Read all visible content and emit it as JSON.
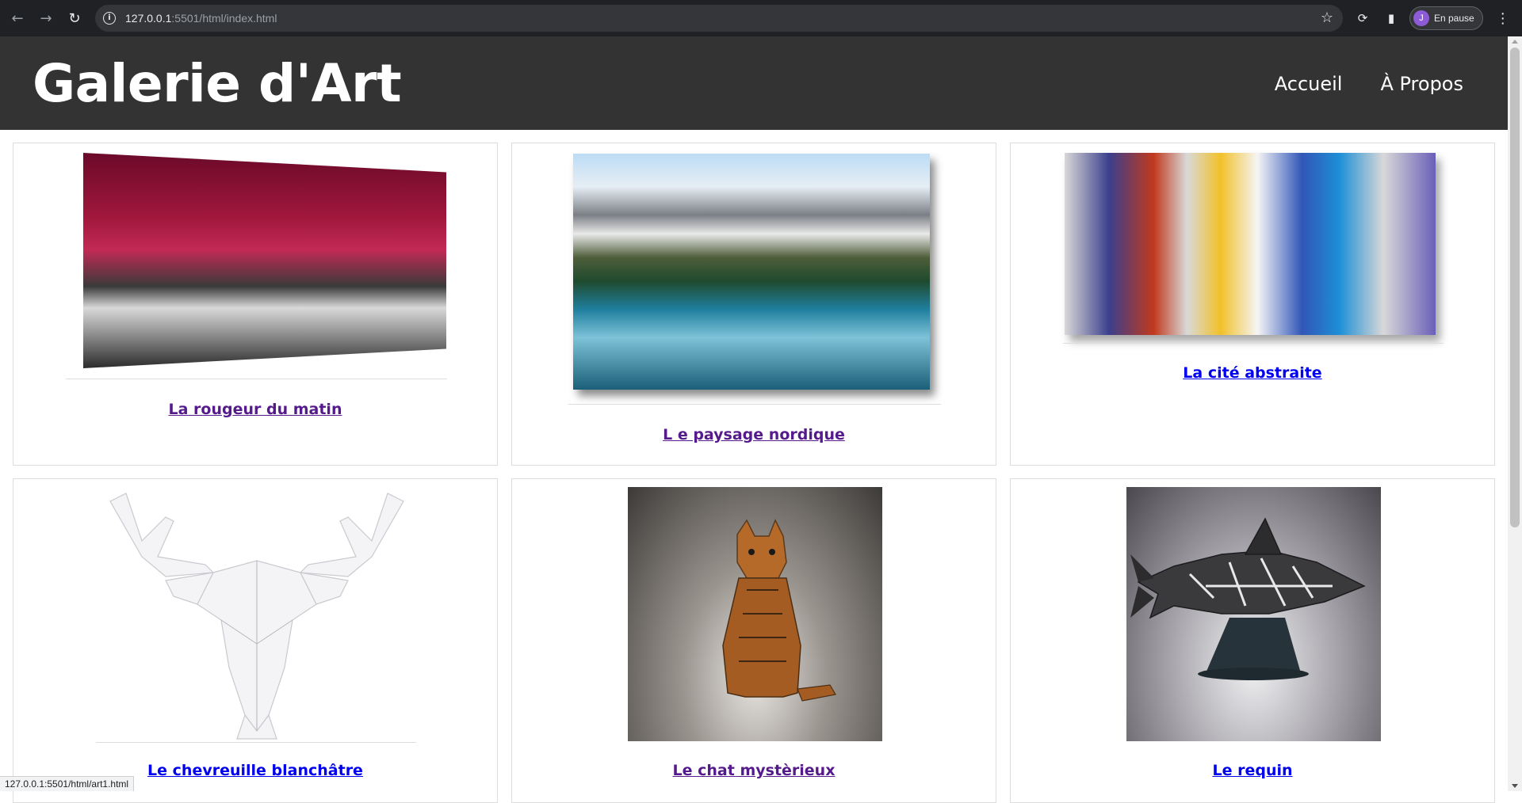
{
  "browser": {
    "url_host": "127.0.0.1",
    "url_path": ":5501/html/index.html",
    "profile_initial": "J",
    "profile_status": "En pause"
  },
  "site": {
    "title": "Galerie d'Art",
    "nav": [
      "Accueil",
      "À Propos"
    ]
  },
  "gallery": {
    "artworks": [
      {
        "title": "La rougeur du matin",
        "visited": true
      },
      {
        "title": "L e paysage nordique",
        "visited": true
      },
      {
        "title": "La cité abstraite",
        "visited": false
      },
      {
        "title": "Le chevreuille blanchâtre",
        "visited": false
      },
      {
        "title": "Le chat mystèrieux",
        "visited": true
      },
      {
        "title": "Le requin",
        "visited": false
      }
    ]
  },
  "status_bar": {
    "hover_url": "127.0.0.1:5501/html/art1.html"
  }
}
